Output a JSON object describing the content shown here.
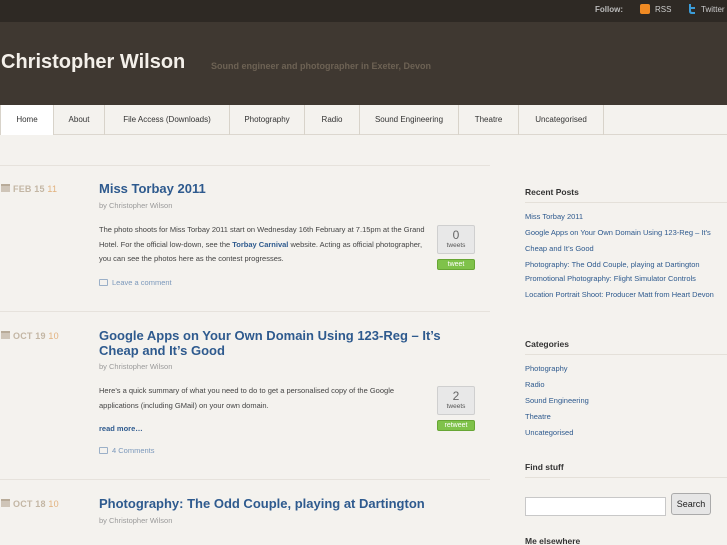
{
  "topbar": {
    "follow_label": "Follow:",
    "rss_label": "RSS",
    "twitter_label": "Twitter"
  },
  "header": {
    "site_title": "Christopher Wilson",
    "tagline": "Sound engineer and photographer in Exeter, Devon"
  },
  "nav": {
    "items": [
      "Home",
      "About",
      "File Access (Downloads)",
      "Photography",
      "Radio",
      "Sound Engineering",
      "Theatre",
      "Uncategorised"
    ]
  },
  "posts": [
    {
      "date": "FEB 15",
      "year": "11",
      "title": "Miss Torbay 2011",
      "byline": "by Christopher Wilson",
      "excerpt_1": "The photo shoots for Miss Torbay 2011 start on Wednesday 16th February at 7.15pm at the Grand Hotel. For the official low-down, see the ",
      "excerpt_link": "Torbay Carnival",
      "excerpt_2": " website. Acting as official photographer, you can see the photos here as the contest progresses.",
      "comments": "Leave a comment",
      "tweet_count": "0",
      "tweet_word": "tweets",
      "tweet_button": "tweet"
    },
    {
      "date": "OCT 19",
      "year": "10",
      "title": "Google Apps on Your Own Domain Using 123-Reg – It’s Cheap and It’s Good",
      "byline": "by Christopher Wilson",
      "excerpt": "Here’s a quick summary of what you need to do to get a personalised copy of the Google applications (including GMail) on your own domain.",
      "read_more": "read more…",
      "comments": "4 Comments",
      "tweet_count": "2",
      "tweet_word": "tweets",
      "tweet_button": "retweet"
    },
    {
      "date": "OCT 18",
      "year": "10",
      "title": "Photography: The Odd Couple, playing at Dartington",
      "byline": "by Christopher Wilson"
    }
  ],
  "sidebar": {
    "recent_posts_heading": "Recent Posts",
    "recent_posts": [
      "Miss Torbay 2011",
      "Google Apps on Your Own Domain Using 123-Reg – It’s Cheap and It’s Good",
      "Photography: The Odd Couple, playing at Dartington",
      "Promotional Photography: Flight Simulator Controls",
      "Location Portrait Shoot: Producer Matt from Heart Devon"
    ],
    "categories_heading": "Categories",
    "categories": [
      "Photography",
      "Radio",
      "Sound Engineering",
      "Theatre",
      "Uncategorised"
    ],
    "find_heading": "Find stuff",
    "search_button": "Search",
    "elsewhere_heading": "Me elsewhere"
  },
  "colors": {
    "topbar_bg": "#2e2924",
    "header_bg": "#3f3831",
    "link": "#2e5a8e",
    "tweet_green": "#7fc24a"
  }
}
